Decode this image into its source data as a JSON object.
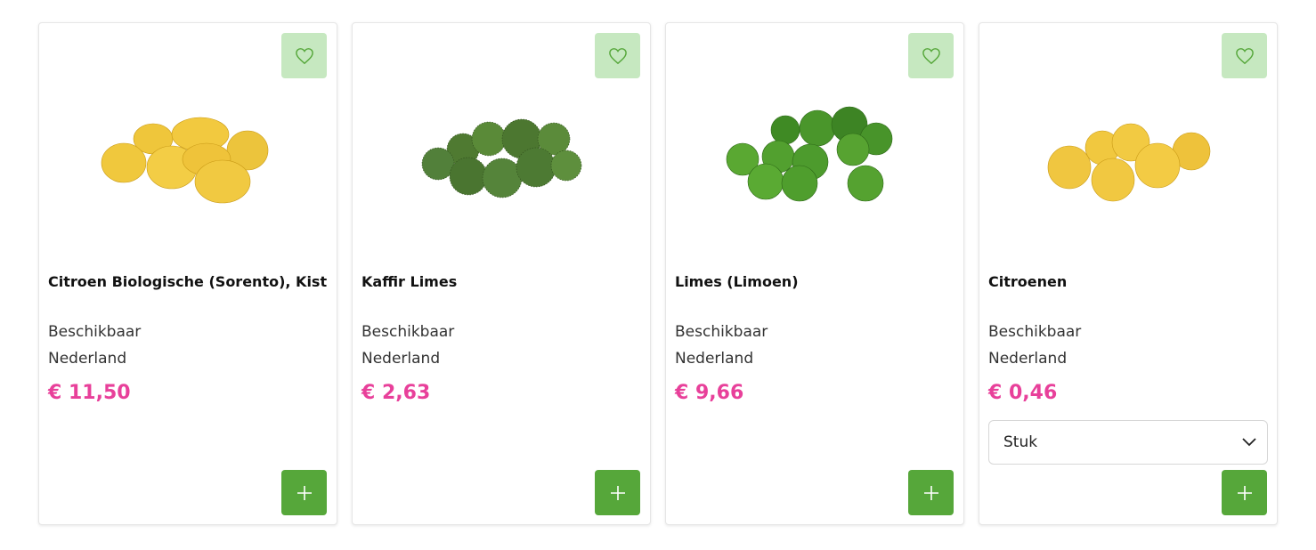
{
  "colors": {
    "favorite_bg": "#c6e8c0",
    "favorite_icon": "#56a73a",
    "add_button": "#56a73a",
    "price": "#e8409a"
  },
  "products": [
    {
      "name": "Citroen Biologische (Sorento), Kist",
      "availability": "Beschikbaar",
      "origin": "Nederland",
      "price": "€ 11,50",
      "image_icon": "lemons-image"
    },
    {
      "name": "Kaffir Limes",
      "availability": "Beschikbaar",
      "origin": "Nederland",
      "price": "€ 2,63",
      "image_icon": "kaffir-limes-image"
    },
    {
      "name": "Limes (Limoen)",
      "availability": "Beschikbaar",
      "origin": "Nederland",
      "price": "€ 9,66",
      "image_icon": "limes-image"
    },
    {
      "name": "Citroenen",
      "availability": "Beschikbaar",
      "origin": "Nederland",
      "price": "€ 0,46",
      "unit_select": "Stuk",
      "image_icon": "lemons-image"
    }
  ],
  "icons": {
    "favorite": "heart-icon",
    "add": "plus-icon",
    "dropdown": "chevron-down-icon"
  }
}
